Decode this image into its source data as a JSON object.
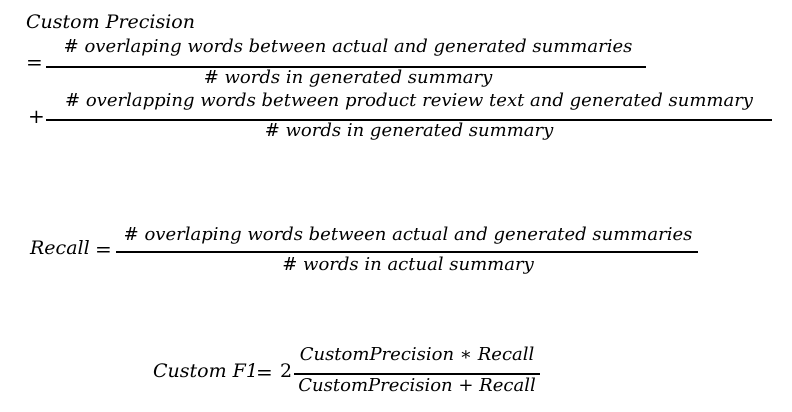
{
  "custom_precision": {
    "title": "Custom Precision",
    "equals": "=",
    "plus": "+",
    "term1_numerator": "# overlaping words between actual and generated summaries",
    "term1_denominator": "# words in generated summary",
    "term2_numerator": "# overlapping words between product review text and generated summary",
    "term2_denominator": "# words in generated summary"
  },
  "recall": {
    "lhs": "Recall",
    "equals": "=",
    "numerator": "# overlaping words between actual and generated summaries",
    "denominator": "# words in actual summary"
  },
  "custom_f1": {
    "lhs": "Custom F1",
    "equals": "=",
    "coefficient": "2",
    "numerator": "CustomPrecision ∗ Recall",
    "denominator": "CustomPrecision + Recall"
  }
}
